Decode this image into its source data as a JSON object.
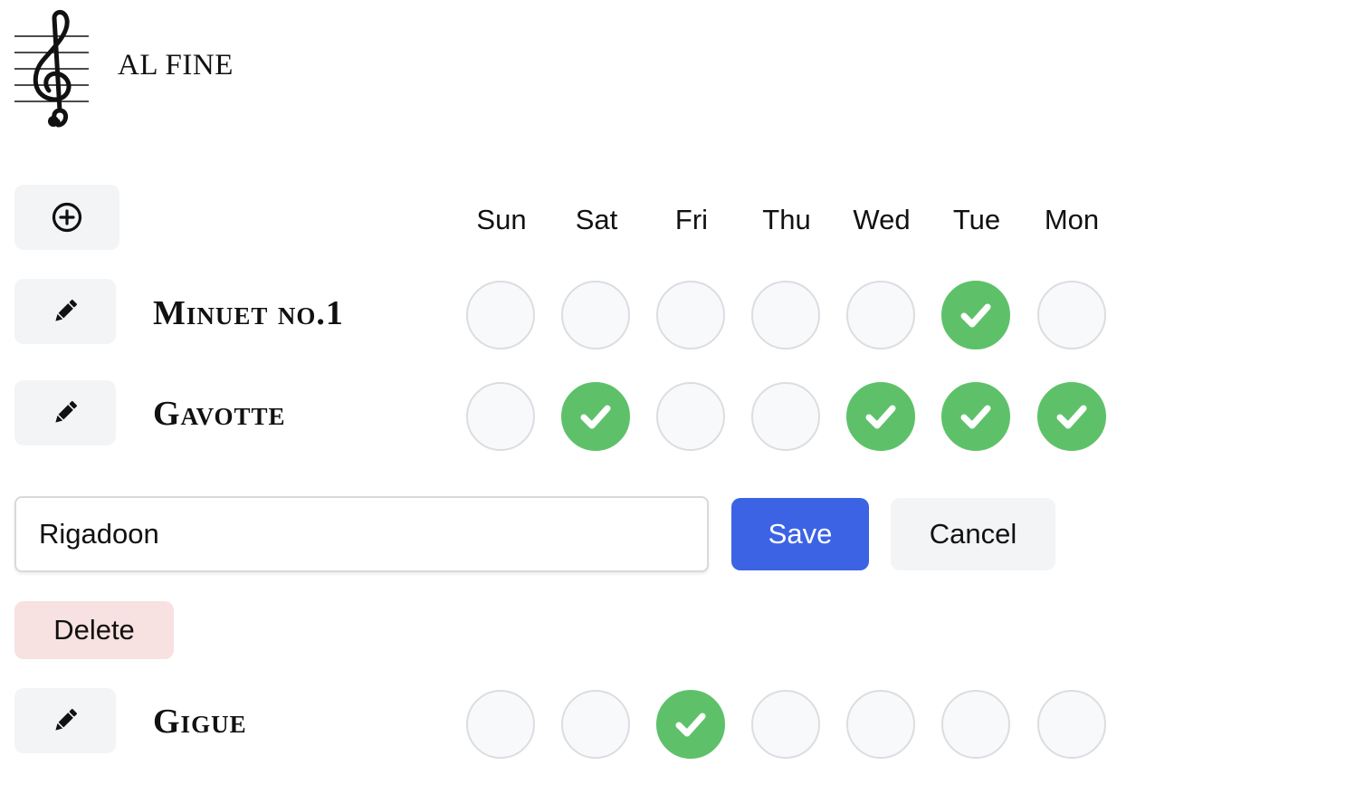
{
  "app": {
    "title": "AL FINE",
    "logo_icon": "treble-clef-icon"
  },
  "toolbar": {
    "add_icon": "plus-circle-icon"
  },
  "days": [
    "Sun",
    "Sat",
    "Fri",
    "Thu",
    "Wed",
    "Tue",
    "Mon"
  ],
  "habits": [
    {
      "name": "Minuet no.1",
      "edit_icon": "pencil-icon",
      "done": [
        false,
        false,
        false,
        false,
        false,
        true,
        false
      ]
    },
    {
      "name": "Gavotte",
      "edit_icon": "pencil-icon",
      "done": [
        false,
        true,
        false,
        false,
        true,
        true,
        true
      ]
    },
    {
      "name": "Gigue",
      "edit_icon": "pencil-icon",
      "done": [
        false,
        false,
        true,
        false,
        false,
        false,
        false
      ]
    }
  ],
  "editor": {
    "input_value": "Rigadoon",
    "save_label": "Save",
    "cancel_label": "Cancel",
    "delete_label": "Delete"
  },
  "colors": {
    "done": "#5ec16a",
    "primary": "#3b63e4",
    "danger_bg": "#f7e1e1",
    "button_bg": "#f3f4f6"
  }
}
